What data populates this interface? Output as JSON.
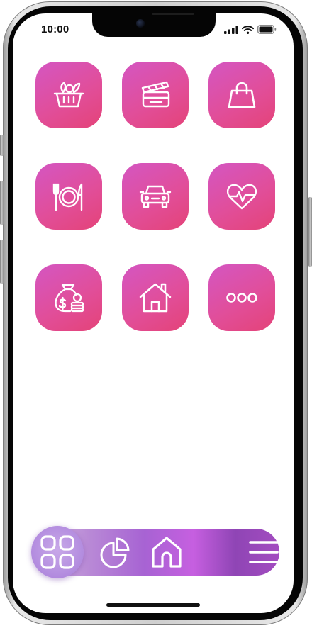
{
  "status_bar": {
    "time": "10:00",
    "icons": [
      "signal-icon",
      "wifi-icon",
      "battery-icon"
    ]
  },
  "categories": [
    {
      "name": "groceries",
      "icon": "basket-icon"
    },
    {
      "name": "entertainment",
      "icon": "clapperboard-icon"
    },
    {
      "name": "shopping",
      "icon": "shopping-bag-icon"
    },
    {
      "name": "dining",
      "icon": "plate-cutlery-icon"
    },
    {
      "name": "car",
      "icon": "car-icon"
    },
    {
      "name": "health",
      "icon": "heartbeat-icon"
    },
    {
      "name": "savings",
      "icon": "money-bag-icon"
    },
    {
      "name": "home",
      "icon": "house-icon"
    },
    {
      "name": "more",
      "icon": "more-dots-icon"
    }
  ],
  "tab_bar": {
    "active": "categories",
    "items": [
      "grid-icon",
      "pie-chart-icon",
      "home-icon",
      "menu-icon"
    ]
  },
  "colors": {
    "tile_gradient_start": "#d456c2",
    "tile_gradient_end": "#e44378",
    "tabbar_purple": "#a763d3",
    "icon_stroke": "#ffffff"
  }
}
